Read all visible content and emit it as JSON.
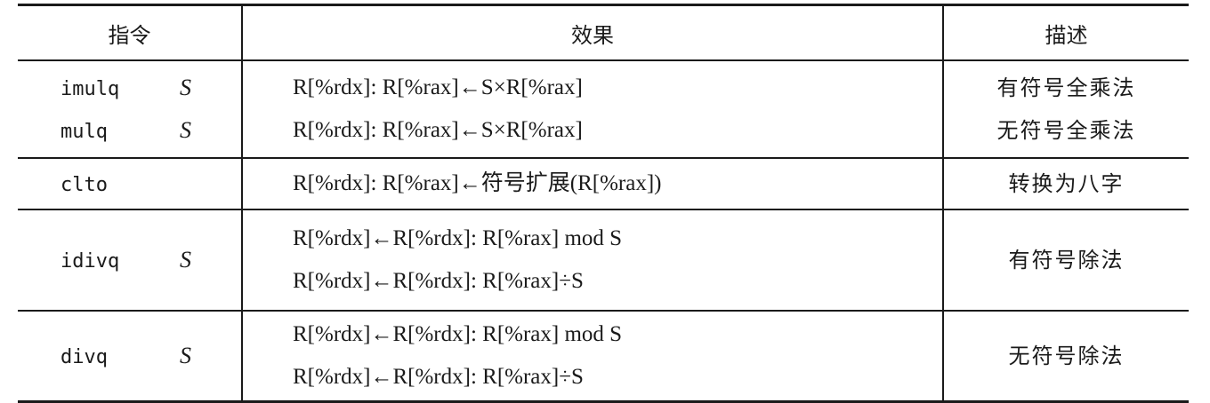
{
  "header": {
    "instruction": "指令",
    "effect": "效果",
    "description": "描述"
  },
  "rows": [
    {
      "instructions": [
        {
          "opcode": "imulq",
          "operand": "S"
        },
        {
          "opcode": "mulq",
          "operand": "S"
        }
      ],
      "effects": [
        "R[%rdx]: R[%rax]←S×R[%rax]",
        "R[%rdx]: R[%rax]←S×R[%rax]"
      ],
      "descriptions": [
        "有符号全乘法",
        "无符号全乘法"
      ]
    },
    {
      "instructions": [
        {
          "opcode": "clto",
          "operand": ""
        }
      ],
      "effects": [
        "R[%rdx]: R[%rax]←符号扩展(R[%rax])"
      ],
      "descriptions": [
        "转换为八字"
      ]
    },
    {
      "instructions": [
        {
          "opcode": "idivq",
          "operand": "S"
        }
      ],
      "effects": [
        "R[%rdx]←R[%rdx]: R[%rax] mod S",
        "R[%rdx]←R[%rdx]: R[%rax]÷S"
      ],
      "descriptions": [
        "有符号除法"
      ]
    },
    {
      "instructions": [
        {
          "opcode": "divq",
          "operand": "S"
        }
      ],
      "effects": [
        "R[%rdx]←R[%rdx]: R[%rax] mod S",
        "R[%rdx]←R[%rdx]: R[%rax]÷S"
      ],
      "descriptions": [
        "无符号除法"
      ]
    }
  ]
}
